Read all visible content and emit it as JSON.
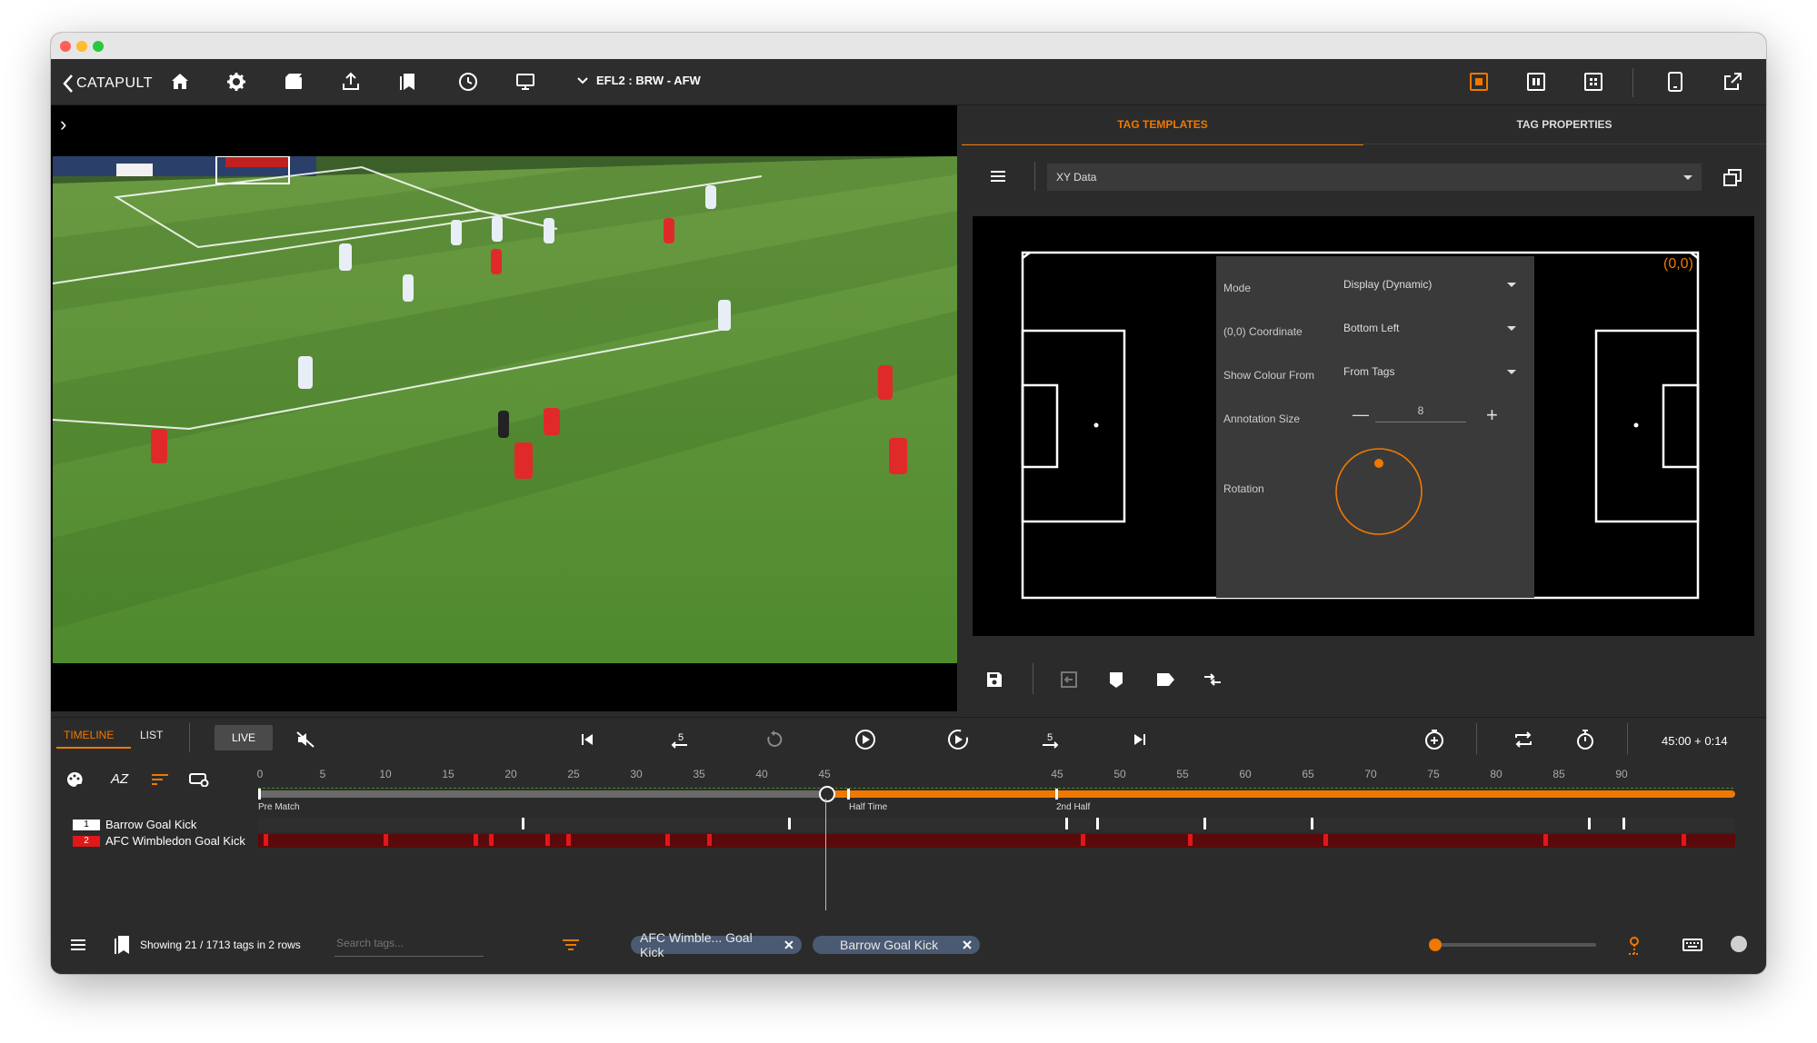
{
  "app": {
    "brand": "CATAPULT",
    "breadcrumb": "EFL2 : BRW - AFW"
  },
  "video": {
    "expand_glyph": "›"
  },
  "right_panel": {
    "tabs": [
      {
        "label": "TAG TEMPLATES"
      },
      {
        "label": "TAG PROPERTIES"
      }
    ],
    "template_select": "XY Data",
    "origin_label": "(0,0)",
    "settings": {
      "mode": {
        "label": "Mode",
        "value": "Display (Dynamic)"
      },
      "coordinate": {
        "label": "(0,0) Coordinate",
        "value": "Bottom Left"
      },
      "colour": {
        "label": "Show Colour From",
        "value": "From Tags"
      },
      "annotation_size": {
        "label": "Annotation Size",
        "value": "8",
        "minus": "—",
        "plus": "+"
      },
      "rotation": {
        "label": "Rotation"
      }
    }
  },
  "bottom": {
    "tabs": {
      "timeline": "TIMELINE",
      "list": "LIST"
    },
    "live": "LIVE",
    "time_readout": "45:00 + 0:14",
    "sort_label": "AZ",
    "ticks_first_half": [
      "0",
      "5",
      "10",
      "15",
      "20",
      "25",
      "30",
      "35",
      "40",
      "45"
    ],
    "ticks_second_half": [
      "45",
      "50",
      "55",
      "60",
      "65",
      "70",
      "75",
      "80",
      "85",
      "90"
    ],
    "phases": {
      "pre_match": "Pre Match",
      "half_time": "Half Time",
      "second_half": "2nd Half"
    },
    "rows": [
      {
        "num": "1",
        "label": "Barrow Goal Kick"
      },
      {
        "num": "2",
        "label": "AFC Wimbledon Goal Kick"
      }
    ],
    "status": "Showing 21 / 1713 tags in 2 rows",
    "search_placeholder": "Search tags...",
    "filters": [
      {
        "label": "AFC Wimble... Goal Kick"
      },
      {
        "label": "Barrow Goal Kick"
      }
    ]
  },
  "colors": {
    "accent": "#f07800",
    "team1": "#ffffff",
    "team2": "#e01818"
  }
}
